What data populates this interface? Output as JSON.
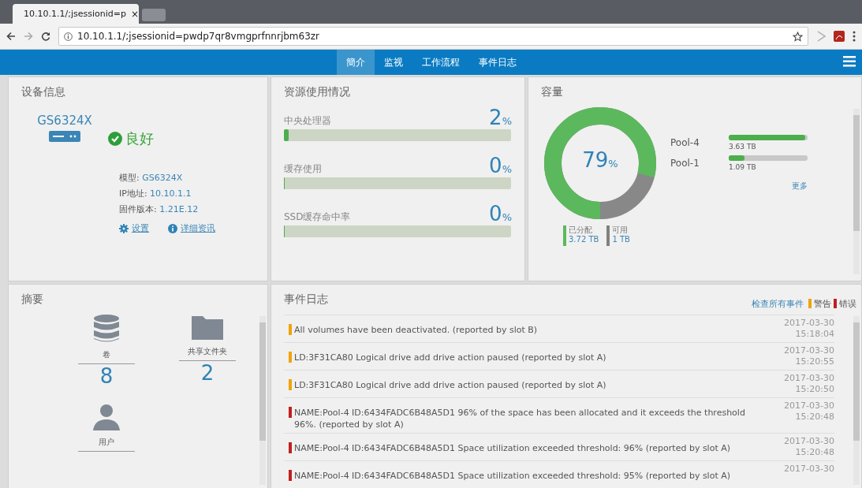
{
  "browser": {
    "tab_title": "10.10.1.1/;jsessionid=p",
    "tab_close": "×",
    "address": "10.10.1.1/;jsessionid=pwdp7qr8vmgprfnnrjbm63zr"
  },
  "nav": {
    "items": [
      {
        "label": "簡介",
        "selected": true
      },
      {
        "label": "监视",
        "selected": false
      },
      {
        "label": "工作流程",
        "selected": false
      },
      {
        "label": "事件日志",
        "selected": false
      }
    ]
  },
  "device": {
    "title": "设备信息",
    "model_name": "GS6324X",
    "status": "良好",
    "info": [
      {
        "label": "模型:",
        "value": "GS6324X"
      },
      {
        "label": "IP地址:",
        "value": "10.10.1.1"
      },
      {
        "label": "固件版本:",
        "value": "1.21E.12"
      }
    ],
    "links": [
      {
        "kind": "settings",
        "label": "设置"
      },
      {
        "kind": "info",
        "label": "详细资讯"
      }
    ]
  },
  "resources": {
    "title": "资源使用情况",
    "meters": [
      {
        "label": "中央处理器",
        "value": "2",
        "unit": "%",
        "level": 0.02
      },
      {
        "label": "缓存使用",
        "value": "0",
        "unit": "%",
        "level": 0
      },
      {
        "label": "SSD缓存命中率",
        "value": "0",
        "unit": "%",
        "level": 0
      }
    ]
  },
  "capacity": {
    "title": "容量",
    "center": "79",
    "unit": "%",
    "level": 0.79,
    "pools": [
      {
        "name": "Pool-4",
        "size": "3.63 TB",
        "level": 0.97
      },
      {
        "name": "Pool-1",
        "size": "1.09 TB",
        "level": 0.2
      }
    ],
    "more": "更多",
    "legend": [
      {
        "label": "已分配",
        "value": "3.72 TB",
        "color": "#5cb85c"
      },
      {
        "label": "可用",
        "value": "1 TB",
        "color": "#808080"
      }
    ]
  },
  "summary": {
    "title": "摘要",
    "items": [
      {
        "kind": "volume",
        "label": "卷",
        "count": "8"
      },
      {
        "kind": "folder",
        "label": "共享文件夹",
        "count": "2"
      },
      {
        "kind": "user",
        "label": "用户"
      }
    ]
  },
  "events": {
    "title": "事件日志",
    "view_all": "检查所有事件",
    "legend": [
      {
        "label": "警告",
        "color": "#f0a30a"
      },
      {
        "label": "错误",
        "color": "#c0201f"
      }
    ],
    "rows": [
      {
        "color": "#f0a30a",
        "message": "All volumes have been deactivated. (reported by slot B)",
        "date": "2017-03-30",
        "time": "15:18:04"
      },
      {
        "color": "#f0a30a",
        "message": "LD:3F31CA80 Logical drive add drive action paused (reported by slot A)",
        "date": "2017-03-30",
        "time": "15:20:55"
      },
      {
        "color": "#f0a30a",
        "message": "LD:3F31CA80 Logical drive add drive action paused (reported by slot A)",
        "date": "2017-03-30",
        "time": "15:20:50"
      },
      {
        "color": "#c0201f",
        "message": "NAME:Pool-4 ID:6434FADC6B48A5D1 96% of the space has been allocated and it exceeds the threshold 96%. (reported by slot A)",
        "date": "2017-03-30",
        "time": "15:20:48"
      },
      {
        "color": "#c0201f",
        "message": "NAME:Pool-4 ID:6434FADC6B48A5D1 Space utilization exceeded threshold: 96% (reported by slot A)",
        "date": "2017-03-30",
        "time": "15:20:48"
      },
      {
        "color": "#c0201f",
        "message": "NAME:Pool-4 ID:6434FADC6B48A5D1 Space utilization exceeded threshold: 95% (reported by slot A)",
        "date": "2017-03-30"
      }
    ]
  }
}
